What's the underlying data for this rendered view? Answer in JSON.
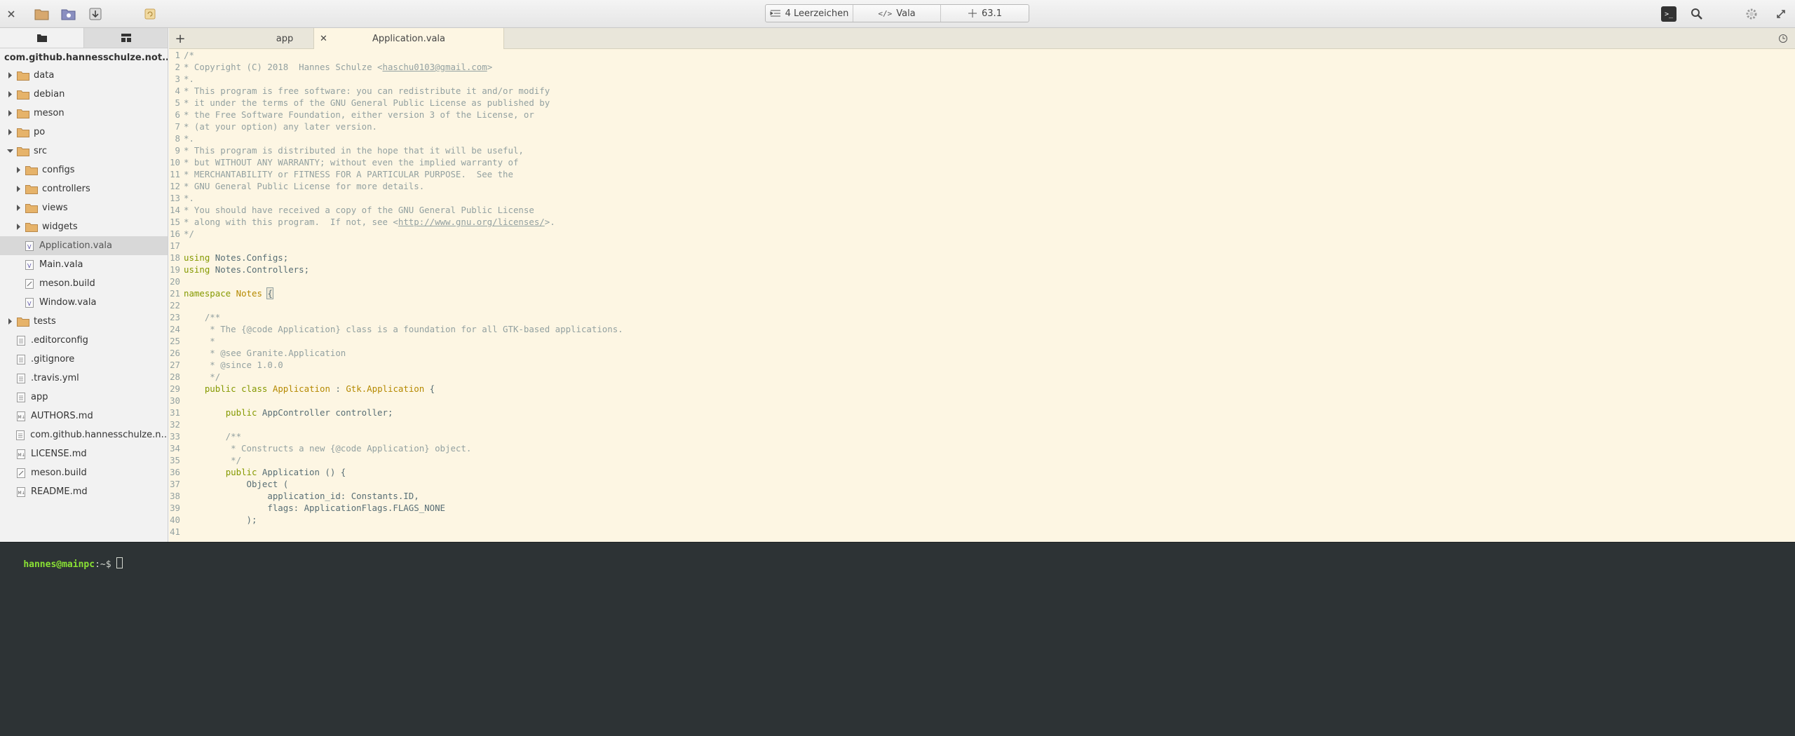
{
  "header": {
    "icons": [
      "close-icon",
      "open-folder-icon",
      "project-icon",
      "save-icon",
      "revert-icon",
      "terminal-icon",
      "search-icon",
      "gear-icon",
      "restore-icon"
    ],
    "indent_label": "4 Leerzeichen",
    "language_label": "Vala",
    "cursor_position": "63.1"
  },
  "sidebar": {
    "tabs": [
      "folder-tab",
      "symbols-tab"
    ],
    "project_root": "com.github.hannesschulze.not...",
    "items": [
      {
        "label": "data",
        "type": "folder",
        "depth": 0,
        "expanded": false
      },
      {
        "label": "debian",
        "type": "folder",
        "depth": 0,
        "expanded": false
      },
      {
        "label": "meson",
        "type": "folder",
        "depth": 0,
        "expanded": false
      },
      {
        "label": "po",
        "type": "folder",
        "depth": 0,
        "expanded": false
      },
      {
        "label": "src",
        "type": "folder",
        "depth": 0,
        "expanded": true
      },
      {
        "label": "configs",
        "type": "folder",
        "depth": 1,
        "expanded": false
      },
      {
        "label": "controllers",
        "type": "folder",
        "depth": 1,
        "expanded": false
      },
      {
        "label": "views",
        "type": "folder",
        "depth": 1,
        "expanded": false
      },
      {
        "label": "widgets",
        "type": "folder",
        "depth": 1,
        "expanded": false
      },
      {
        "label": "Application.vala",
        "type": "vala",
        "depth": 1,
        "selected": true
      },
      {
        "label": "Main.vala",
        "type": "vala",
        "depth": 1
      },
      {
        "label": "meson.build",
        "type": "build",
        "depth": 1
      },
      {
        "label": "Window.vala",
        "type": "vala",
        "depth": 1
      },
      {
        "label": "tests",
        "type": "folder",
        "depth": 0,
        "expanded": false
      },
      {
        "label": ".editorconfig",
        "type": "text",
        "depth": 0
      },
      {
        "label": ".gitignore",
        "type": "text",
        "depth": 0
      },
      {
        "label": ".travis.yml",
        "type": "text",
        "depth": 0
      },
      {
        "label": "app",
        "type": "text",
        "depth": 0
      },
      {
        "label": "AUTHORS.md",
        "type": "md",
        "depth": 0
      },
      {
        "label": "com.github.hannesschulze.note...",
        "type": "text",
        "depth": 0
      },
      {
        "label": "LICENSE.md",
        "type": "md",
        "depth": 0
      },
      {
        "label": "meson.build",
        "type": "build",
        "depth": 0
      },
      {
        "label": "README.md",
        "type": "md",
        "depth": 0
      }
    ]
  },
  "editor": {
    "tabs": [
      {
        "label": "app",
        "active": false
      },
      {
        "label": "Application.vala",
        "active": true
      }
    ],
    "lines": [
      {
        "n": "1",
        "t": "/*"
      },
      {
        "n": "2",
        "t": "* Copyright (C) 2018  Hannes Schulze <haschu0103@gmail.com>"
      },
      {
        "n": "3",
        "t": "*."
      },
      {
        "n": "4",
        "t": "* This program is free software: you can redistribute it and/or modify"
      },
      {
        "n": "5",
        "t": "* it under the terms of the GNU General Public License as published by"
      },
      {
        "n": "6",
        "t": "* the Free Software Foundation, either version 3 of the License, or"
      },
      {
        "n": "7",
        "t": "* (at your option) any later version."
      },
      {
        "n": "8",
        "t": "*."
      },
      {
        "n": "9",
        "t": "* This program is distributed in the hope that it will be useful,"
      },
      {
        "n": "10",
        "t": "* but WITHOUT ANY WARRANTY; without even the implied warranty of"
      },
      {
        "n": "11",
        "t": "* MERCHANTABILITY or FITNESS FOR A PARTICULAR PURPOSE.  See the"
      },
      {
        "n": "12",
        "t": "* GNU General Public License for more details."
      },
      {
        "n": "13",
        "t": "*."
      },
      {
        "n": "14",
        "t": "* You should have received a copy of the GNU General Public License"
      },
      {
        "n": "15",
        "t": "* along with this program.  If not, see <http://www.gnu.org/licenses/>."
      },
      {
        "n": "16",
        "t": "*/"
      },
      {
        "n": "17",
        "t": ""
      },
      {
        "n": "18",
        "t": "using Notes.Configs;"
      },
      {
        "n": "19",
        "t": "using Notes.Controllers;"
      },
      {
        "n": "20",
        "t": ""
      },
      {
        "n": "21",
        "t": "namespace Notes {"
      },
      {
        "n": "22",
        "t": ""
      },
      {
        "n": "23",
        "t": "    /**"
      },
      {
        "n": "24",
        "t": "     * The {@code Application} class is a foundation for all GTK-based applications."
      },
      {
        "n": "25",
        "t": "     *"
      },
      {
        "n": "26",
        "t": "     * @see Granite.Application"
      },
      {
        "n": "27",
        "t": "     * @since 1.0.0"
      },
      {
        "n": "28",
        "t": "     */"
      },
      {
        "n": "29",
        "t": "    public class Application : Gtk.Application {"
      },
      {
        "n": "30",
        "t": ""
      },
      {
        "n": "31",
        "t": "        public AppController controller;"
      },
      {
        "n": "32",
        "t": ""
      },
      {
        "n": "33",
        "t": "        /**"
      },
      {
        "n": "34",
        "t": "         * Constructs a new {@code Application} object."
      },
      {
        "n": "35",
        "t": "         */"
      },
      {
        "n": "36",
        "t": "        public Application () {"
      },
      {
        "n": "37",
        "t": "            Object ("
      },
      {
        "n": "38",
        "t": "                application_id: Constants.ID,"
      },
      {
        "n": "39",
        "t": "                flags: ApplicationFlags.FLAGS_NONE"
      },
      {
        "n": "40",
        "t": "            );"
      },
      {
        "n": "41",
        "t": ""
      }
    ]
  },
  "terminal": {
    "user_host": "hannes@mainpc",
    "path_prompt": ":~$ "
  },
  "colors": {
    "editor_bg": "#fdf6e3",
    "comment": "#93a1a1",
    "keyword": "#859900",
    "type": "#b58900",
    "terminal_bg": "#2d3335",
    "prompt_user": "#8ae234"
  }
}
